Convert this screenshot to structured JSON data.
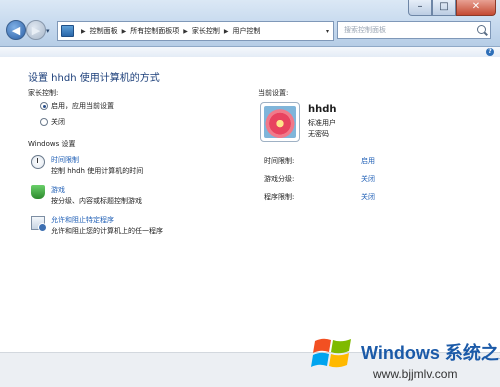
{
  "window": {
    "minimize": "–",
    "maximize": "□",
    "close": "✕"
  },
  "nav": {
    "back": "◀",
    "forward": "▶",
    "recent": "▾"
  },
  "address": {
    "crumbs": [
      "控制面板",
      "所有控制面板项",
      "家长控制",
      "用户控制"
    ],
    "separator": "▶"
  },
  "search": {
    "placeholder": "搜索控制面板"
  },
  "page": {
    "title": "设置 hhdh 使用计算机的方式",
    "parental_control_label": "家长控制:",
    "options": [
      {
        "label": "启用，应用当前设置",
        "selected": true
      },
      {
        "label": "关闭",
        "selected": false
      }
    ],
    "windows_settings_label": "Windows 设置",
    "settings": [
      {
        "link": "时间限制",
        "desc": "控制 hhdh 使用计算机的时间",
        "icon": "clock-icon"
      },
      {
        "link": "游戏",
        "desc": "按分级、内容或标题控制游戏",
        "icon": "trophy-icon"
      },
      {
        "link": "允许和阻止特定程序",
        "desc": "允许和阻止您的计算机上的任一程序",
        "icon": "program-icon"
      }
    ]
  },
  "current": {
    "label": "当前设置:",
    "user_name": "hhdh",
    "user_type": "标准用户",
    "password": "无密码",
    "rows": [
      {
        "label": "时间限制:",
        "value": "启用"
      },
      {
        "label": "游戏分级:",
        "value": "关闭"
      },
      {
        "label": "程序限制:",
        "value": "关闭"
      }
    ]
  },
  "watermark": {
    "title": "Windows 系统之家",
    "url": "www.bjjmlv.com"
  },
  "colors": {
    "link": "#1f5fb6",
    "heading": "#1c3f7a"
  }
}
